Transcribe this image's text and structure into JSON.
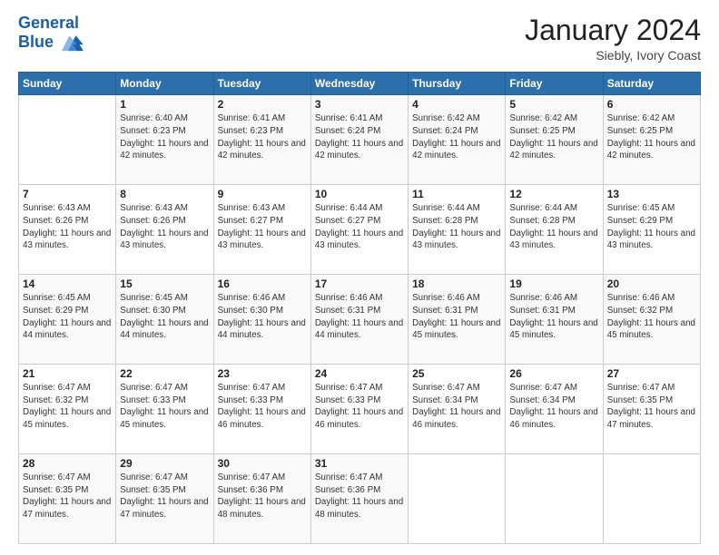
{
  "header": {
    "logo_line1": "General",
    "logo_line2": "Blue",
    "month": "January 2024",
    "location": "Siebly, Ivory Coast"
  },
  "days_of_week": [
    "Sunday",
    "Monday",
    "Tuesday",
    "Wednesday",
    "Thursday",
    "Friday",
    "Saturday"
  ],
  "weeks": [
    [
      {
        "day": "",
        "sunrise": "",
        "sunset": "",
        "daylight": ""
      },
      {
        "day": "1",
        "sunrise": "Sunrise: 6:40 AM",
        "sunset": "Sunset: 6:23 PM",
        "daylight": "Daylight: 11 hours and 42 minutes."
      },
      {
        "day": "2",
        "sunrise": "Sunrise: 6:41 AM",
        "sunset": "Sunset: 6:23 PM",
        "daylight": "Daylight: 11 hours and 42 minutes."
      },
      {
        "day": "3",
        "sunrise": "Sunrise: 6:41 AM",
        "sunset": "Sunset: 6:24 PM",
        "daylight": "Daylight: 11 hours and 42 minutes."
      },
      {
        "day": "4",
        "sunrise": "Sunrise: 6:42 AM",
        "sunset": "Sunset: 6:24 PM",
        "daylight": "Daylight: 11 hours and 42 minutes."
      },
      {
        "day": "5",
        "sunrise": "Sunrise: 6:42 AM",
        "sunset": "Sunset: 6:25 PM",
        "daylight": "Daylight: 11 hours and 42 minutes."
      },
      {
        "day": "6",
        "sunrise": "Sunrise: 6:42 AM",
        "sunset": "Sunset: 6:25 PM",
        "daylight": "Daylight: 11 hours and 42 minutes."
      }
    ],
    [
      {
        "day": "7",
        "sunrise": "Sunrise: 6:43 AM",
        "sunset": "Sunset: 6:26 PM",
        "daylight": "Daylight: 11 hours and 43 minutes."
      },
      {
        "day": "8",
        "sunrise": "Sunrise: 6:43 AM",
        "sunset": "Sunset: 6:26 PM",
        "daylight": "Daylight: 11 hours and 43 minutes."
      },
      {
        "day": "9",
        "sunrise": "Sunrise: 6:43 AM",
        "sunset": "Sunset: 6:27 PM",
        "daylight": "Daylight: 11 hours and 43 minutes."
      },
      {
        "day": "10",
        "sunrise": "Sunrise: 6:44 AM",
        "sunset": "Sunset: 6:27 PM",
        "daylight": "Daylight: 11 hours and 43 minutes."
      },
      {
        "day": "11",
        "sunrise": "Sunrise: 6:44 AM",
        "sunset": "Sunset: 6:28 PM",
        "daylight": "Daylight: 11 hours and 43 minutes."
      },
      {
        "day": "12",
        "sunrise": "Sunrise: 6:44 AM",
        "sunset": "Sunset: 6:28 PM",
        "daylight": "Daylight: 11 hours and 43 minutes."
      },
      {
        "day": "13",
        "sunrise": "Sunrise: 6:45 AM",
        "sunset": "Sunset: 6:29 PM",
        "daylight": "Daylight: 11 hours and 43 minutes."
      }
    ],
    [
      {
        "day": "14",
        "sunrise": "Sunrise: 6:45 AM",
        "sunset": "Sunset: 6:29 PM",
        "daylight": "Daylight: 11 hours and 44 minutes."
      },
      {
        "day": "15",
        "sunrise": "Sunrise: 6:45 AM",
        "sunset": "Sunset: 6:30 PM",
        "daylight": "Daylight: 11 hours and 44 minutes."
      },
      {
        "day": "16",
        "sunrise": "Sunrise: 6:46 AM",
        "sunset": "Sunset: 6:30 PM",
        "daylight": "Daylight: 11 hours and 44 minutes."
      },
      {
        "day": "17",
        "sunrise": "Sunrise: 6:46 AM",
        "sunset": "Sunset: 6:31 PM",
        "daylight": "Daylight: 11 hours and 44 minutes."
      },
      {
        "day": "18",
        "sunrise": "Sunrise: 6:46 AM",
        "sunset": "Sunset: 6:31 PM",
        "daylight": "Daylight: 11 hours and 45 minutes."
      },
      {
        "day": "19",
        "sunrise": "Sunrise: 6:46 AM",
        "sunset": "Sunset: 6:31 PM",
        "daylight": "Daylight: 11 hours and 45 minutes."
      },
      {
        "day": "20",
        "sunrise": "Sunrise: 6:46 AM",
        "sunset": "Sunset: 6:32 PM",
        "daylight": "Daylight: 11 hours and 45 minutes."
      }
    ],
    [
      {
        "day": "21",
        "sunrise": "Sunrise: 6:47 AM",
        "sunset": "Sunset: 6:32 PM",
        "daylight": "Daylight: 11 hours and 45 minutes."
      },
      {
        "day": "22",
        "sunrise": "Sunrise: 6:47 AM",
        "sunset": "Sunset: 6:33 PM",
        "daylight": "Daylight: 11 hours and 45 minutes."
      },
      {
        "day": "23",
        "sunrise": "Sunrise: 6:47 AM",
        "sunset": "Sunset: 6:33 PM",
        "daylight": "Daylight: 11 hours and 46 minutes."
      },
      {
        "day": "24",
        "sunrise": "Sunrise: 6:47 AM",
        "sunset": "Sunset: 6:33 PM",
        "daylight": "Daylight: 11 hours and 46 minutes."
      },
      {
        "day": "25",
        "sunrise": "Sunrise: 6:47 AM",
        "sunset": "Sunset: 6:34 PM",
        "daylight": "Daylight: 11 hours and 46 minutes."
      },
      {
        "day": "26",
        "sunrise": "Sunrise: 6:47 AM",
        "sunset": "Sunset: 6:34 PM",
        "daylight": "Daylight: 11 hours and 46 minutes."
      },
      {
        "day": "27",
        "sunrise": "Sunrise: 6:47 AM",
        "sunset": "Sunset: 6:35 PM",
        "daylight": "Daylight: 11 hours and 47 minutes."
      }
    ],
    [
      {
        "day": "28",
        "sunrise": "Sunrise: 6:47 AM",
        "sunset": "Sunset: 6:35 PM",
        "daylight": "Daylight: 11 hours and 47 minutes."
      },
      {
        "day": "29",
        "sunrise": "Sunrise: 6:47 AM",
        "sunset": "Sunset: 6:35 PM",
        "daylight": "Daylight: 11 hours and 47 minutes."
      },
      {
        "day": "30",
        "sunrise": "Sunrise: 6:47 AM",
        "sunset": "Sunset: 6:36 PM",
        "daylight": "Daylight: 11 hours and 48 minutes."
      },
      {
        "day": "31",
        "sunrise": "Sunrise: 6:47 AM",
        "sunset": "Sunset: 6:36 PM",
        "daylight": "Daylight: 11 hours and 48 minutes."
      },
      {
        "day": "",
        "sunrise": "",
        "sunset": "",
        "daylight": ""
      },
      {
        "day": "",
        "sunrise": "",
        "sunset": "",
        "daylight": ""
      },
      {
        "day": "",
        "sunrise": "",
        "sunset": "",
        "daylight": ""
      }
    ]
  ]
}
